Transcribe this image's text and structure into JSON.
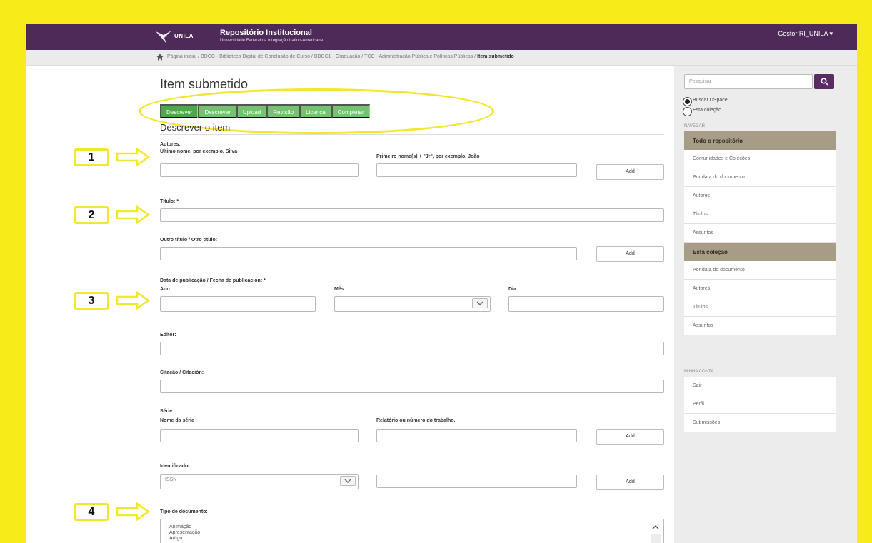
{
  "header": {
    "logo_text": "UNILA",
    "repo_title": "Repositório Institucional",
    "repo_subtitle": "Universidade Federal da Integração Latino-Americana",
    "user_menu": "Gestor RI_UNILA"
  },
  "breadcrumbs": {
    "path": "Página inicial / BDCC - Biblioteca Digital de Conclusão de Curso / BDCC1 - Graduação / TCC - Administração Pública e Políticas Públicas /",
    "current": "Item submetido"
  },
  "page": {
    "title": "Item submetido",
    "section_title": "Descrever o item"
  },
  "steps": [
    {
      "label": "Descrever"
    },
    {
      "label": "Descrever"
    },
    {
      "label": "Upload"
    },
    {
      "label": "Revisão"
    },
    {
      "label": "Licença"
    },
    {
      "label": "Completar"
    }
  ],
  "form": {
    "authors": {
      "label": "Autores:",
      "last_name_label": "Último nome, por exemplo, Silva",
      "first_name_label": "Primeiro nome(s) + \"Jr\", por exemplo, João",
      "add_label": "Add"
    },
    "title": {
      "label": "Título: *"
    },
    "other_title": {
      "label": "Outro título / Otro título:",
      "add_label": "Add"
    },
    "pub_date": {
      "label": "Data de publicação / Fecha de publicación: *",
      "year_label": "Ano",
      "month_label": "Mês",
      "day_label": "Dia"
    },
    "publisher": {
      "label": "Editor:"
    },
    "citation": {
      "label": "Citação / Citación:"
    },
    "series": {
      "label": "Série:",
      "name_label": "Nome da série",
      "report_label": "Relatório ou número do trabalho.",
      "add_label": "Add"
    },
    "identifier": {
      "label": "Identificador:",
      "selected": "ISSN",
      "add_label": "Add"
    },
    "doc_type": {
      "label": "Tipo de documento:",
      "options": [
        "Animação",
        "Apresentação",
        "Artigo"
      ]
    }
  },
  "callouts": [
    "1",
    "2",
    "3",
    "4"
  ],
  "sidebar": {
    "search_placeholder": "Pesquisar",
    "radio_all": "Buscar DSpace",
    "radio_collection": "Esta coleção",
    "nav_caption": "NAVEGAR",
    "repo_head": "Todo o repositório",
    "repo_items": [
      "Comunidades e Coleções",
      "Por data do documento",
      "Autores",
      "Títulos",
      "Assuntos"
    ],
    "collection_head": "Esta coleção",
    "collection_items": [
      "Por data do documento",
      "Autores",
      "Títulos",
      "Assuntos"
    ],
    "account_caption": "MINHA CONTA",
    "account_items": [
      "Sair",
      "Perfil",
      "Submissões"
    ]
  },
  "colors": {
    "header": "#4e2a58",
    "step_green": "#76c36f",
    "highlight_yellow": "#f2e72c",
    "nav_head": "#a79d86"
  }
}
